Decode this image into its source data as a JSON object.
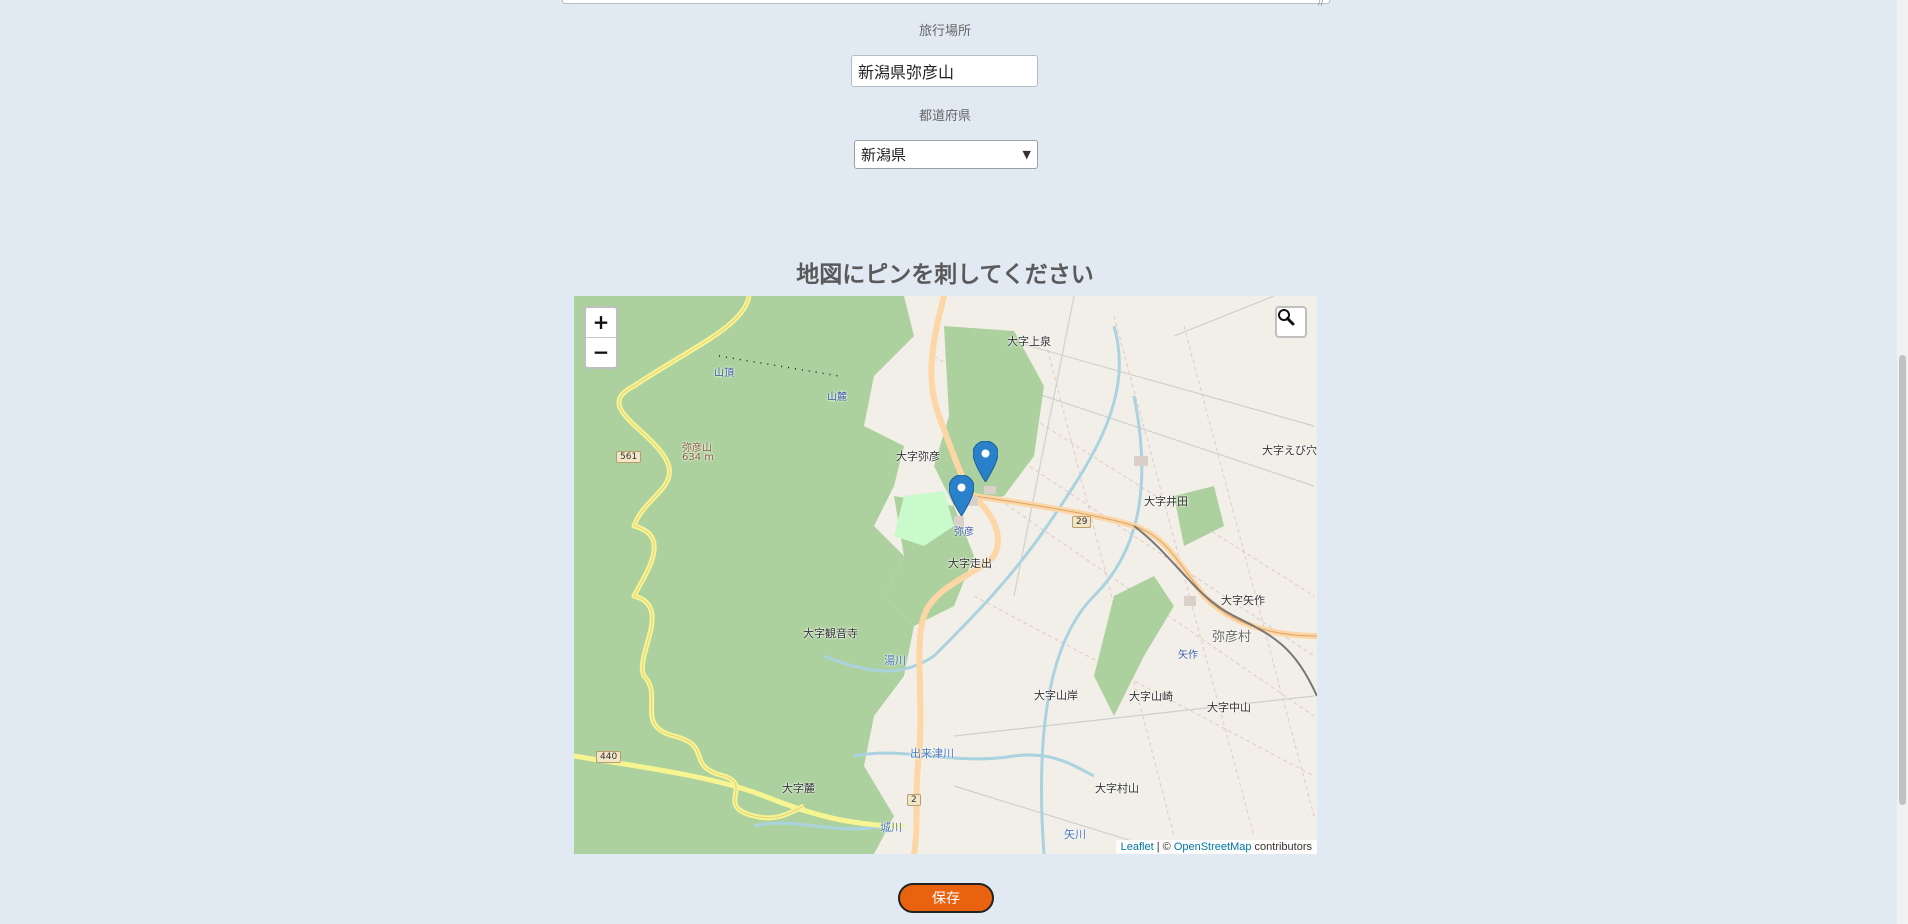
{
  "form": {
    "place_label": "旅行場所",
    "place_value": "新潟県弥彦山",
    "prefecture_label": "都道府県",
    "prefecture_value": "新潟県"
  },
  "map_section": {
    "heading": "地図にピンを刺してください",
    "zoom_in": "+",
    "zoom_out": "−",
    "attribution_leaflet": "Leaflet",
    "attribution_sep": " | © ",
    "attribution_osm": "OpenStreetMap",
    "attribution_tail": " contributors",
    "labels": {
      "oaza_kamiizumi": "大字上泉",
      "oaza_yahiko": "大字弥彦",
      "oaza_ebiana": "大字えび穴",
      "oaza_ida": "大字井田",
      "oaza_hashiride": "大字走出",
      "oaza_kannonji": "大字観音寺",
      "oaza_yasaku": "大字矢作",
      "yahiko_village": "弥彦村",
      "yasaku_station": "矢作",
      "oaza_yamagishi": "大字山岸",
      "oaza_yamazaki": "大字山崎",
      "oaza_nakayama": "大字中山",
      "oaza_fumoto": "大字麓",
      "oaza_murayama": "大字村山",
      "sancho": "山頂",
      "sanroku": "山麓",
      "mt_yahiko": "弥彦山",
      "mt_height": "634 m",
      "yahiko_station": "弥彦",
      "yugawa": "湯川",
      "dekitsugawa": "出来津川",
      "jogawa": "城川",
      "yagawa": "矢川",
      "route_561": "561",
      "route_29": "29",
      "route_440": "440",
      "route_2": "2"
    },
    "markers": 2
  },
  "actions": {
    "save_label": "保存"
  },
  "colors": {
    "page_bg": "#e1e9f3",
    "save_button": "#e8620f",
    "marker": "#2a81cb",
    "forest": "#add19e"
  }
}
